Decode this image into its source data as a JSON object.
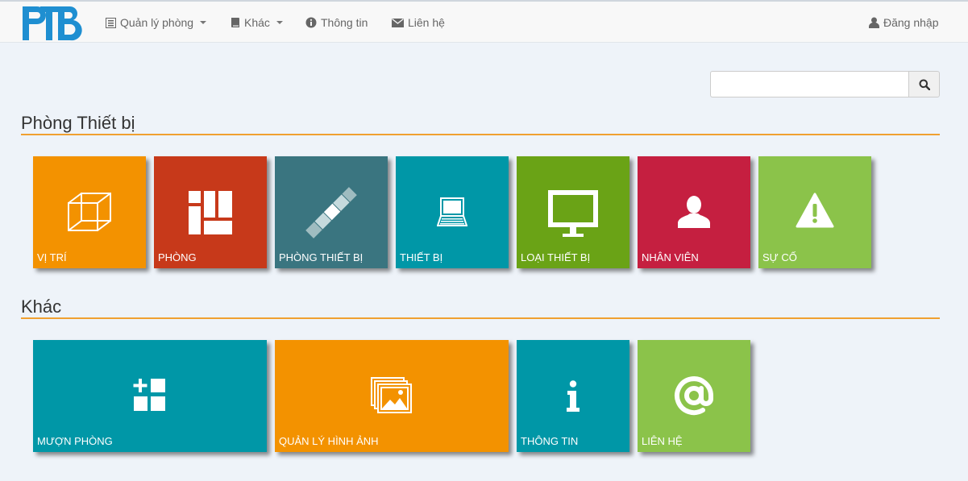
{
  "brand": {
    "logo_text": "PTB",
    "color": "#1f8fd1"
  },
  "nav": {
    "items": [
      {
        "label": "Quản lý phòng",
        "icon": "list-icon",
        "dropdown": true
      },
      {
        "label": "Khác",
        "icon": "book-icon",
        "dropdown": true
      },
      {
        "label": "Thông tin",
        "icon": "info-circle-icon",
        "dropdown": false
      },
      {
        "label": "Liên hệ",
        "icon": "envelope-icon",
        "dropdown": false
      }
    ],
    "login": {
      "label": "Đăng nhập",
      "icon": "user-icon"
    }
  },
  "search": {
    "value": "",
    "placeholder": "",
    "button_icon": "search-icon"
  },
  "sections": [
    {
      "title": "Phòng Thiết bị",
      "tiles": [
        {
          "label": "VỊ TRÍ",
          "icon": "cube-icon",
          "color": "#f39200"
        },
        {
          "label": "PHÒNG",
          "icon": "floorplan-icon",
          "color": "#c7391a"
        },
        {
          "label": "PHÒNG THIẾT BỊ",
          "icon": "ruler-icon",
          "color": "#3a7580"
        },
        {
          "label": "THIẾT BỊ",
          "icon": "laptop-icon",
          "color": "#0097a7"
        },
        {
          "label": "LOẠI THIẾT BỊ",
          "icon": "monitor-icon",
          "color": "#6aa316"
        },
        {
          "label": "NHÂN VIÊN",
          "icon": "person-icon",
          "color": "#c51f40"
        },
        {
          "label": "SỰ CỐ",
          "icon": "warning-icon",
          "color": "#8bc34a"
        }
      ]
    },
    {
      "title": "Khác",
      "tiles": [
        {
          "label": "MƯỢN PHÒNG",
          "icon": "add-grid-icon",
          "color": "#0097a7"
        },
        {
          "label": "QUẢN LÝ HÌNH ẢNH",
          "icon": "images-icon",
          "color": "#f39200"
        },
        {
          "label": "THÔNG TIN",
          "icon": "info-icon",
          "color": "#0097a7"
        },
        {
          "label": "LIÊN HỆ",
          "icon": "at-icon",
          "color": "#8bc34a"
        }
      ]
    }
  ],
  "accent_rule_color": "#f0a030"
}
